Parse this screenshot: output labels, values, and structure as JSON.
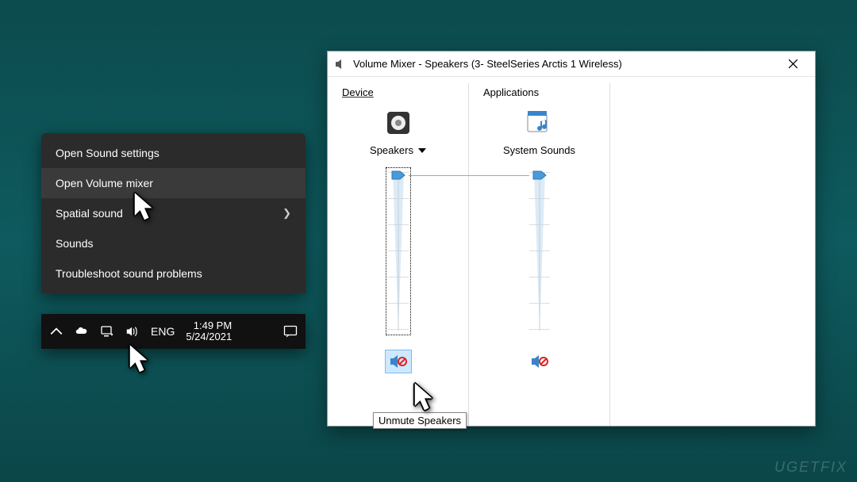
{
  "contextMenu": {
    "items": [
      {
        "label": "Open Sound settings",
        "hasSub": false,
        "highlighted": false
      },
      {
        "label": "Open Volume mixer",
        "hasSub": false,
        "highlighted": true
      },
      {
        "label": "Spatial sound",
        "hasSub": true,
        "highlighted": false
      },
      {
        "label": "Sounds",
        "hasSub": false,
        "highlighted": false
      },
      {
        "label": "Troubleshoot sound problems",
        "hasSub": false,
        "highlighted": false
      }
    ]
  },
  "taskbar": {
    "lang": "ENG",
    "time": "1:49 PM",
    "date": "5/24/2021"
  },
  "mixer": {
    "title": "Volume Mixer - Speakers (3- SteelSeries Arctis 1 Wireless)",
    "deviceHeader": "Device",
    "appsHeader": "Applications",
    "deviceLabel": "Speakers",
    "systemSoundsLabel": "System Sounds",
    "tooltip": "Unmute Speakers"
  },
  "watermark": "UGETFIX"
}
